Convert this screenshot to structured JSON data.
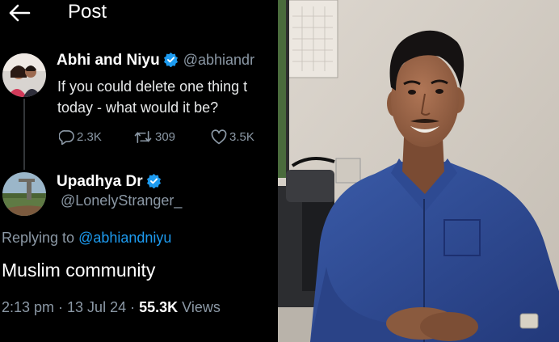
{
  "header": {
    "title": "Post"
  },
  "post": {
    "author_name": "Abhi and Niyu",
    "author_handle": "@abhiandr",
    "text_line1": "If you could delete one thing t",
    "text_line2": "today - what would it be?",
    "replies": "2.3K",
    "reposts": "309",
    "likes": "3.5K"
  },
  "reply": {
    "author_name": "Upadhya Dr",
    "author_handle": "@LonelyStranger_",
    "replying_label": "Replying to ",
    "replying_handle": "@abhiandniyu",
    "text": "Muslim community",
    "time_date": "2:13 pm · 13 Jul 24 · ",
    "views_count": "55.3K",
    "views_label": " Views"
  },
  "colors": {
    "background": "#000000",
    "accent": "#1d9bf0",
    "muted": "#8b98a5",
    "text": "#e7e9ea"
  },
  "icons": [
    "back-arrow-icon",
    "verified-badge-icon",
    "reply-icon",
    "repost-icon",
    "like-icon"
  ]
}
